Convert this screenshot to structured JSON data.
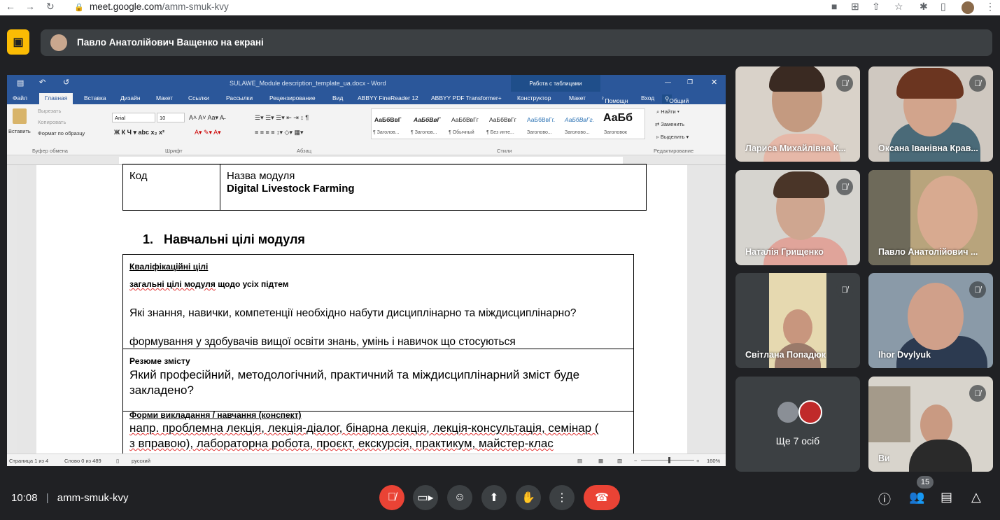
{
  "browser": {
    "url_host": "meet.google.com",
    "url_path": "/amm-smuk-kvy"
  },
  "banner": {
    "presenter_text": "Павло Анатолійович Ващенко на екрані"
  },
  "word": {
    "title": "SULAWE_Module description_template_ua.docx - Word",
    "table_tools": "Работа с таблицами",
    "tabs": [
      "Файл",
      "Главная",
      "Вставка",
      "Дизайн",
      "Макет",
      "Ссылки",
      "Рассылки",
      "Рецензирование",
      "Вид",
      "ABBYY FineReader 12",
      "ABBYY PDF Transformer+",
      "Конструктор",
      "Макет"
    ],
    "help": "Помощн",
    "signin": "Вход",
    "share": "Общий доступ",
    "clipboard": {
      "paste": "Вставить",
      "cut": "Вырезать",
      "copy": "Копировать",
      "format": "Формат по образцу",
      "group": "Буфер обмена"
    },
    "font": {
      "name": "Arial",
      "size": "10",
      "group": "Шрифт"
    },
    "paragraph_group": "Абзац",
    "styles": {
      "samples": [
        "АаБбВвГ",
        "АаБбВвГ",
        "АаБбВвГг",
        "АаБбВвГг",
        "АаБбВвГг.",
        "АаБбВвГг.",
        "АаБб"
      ],
      "names": [
        "¶ Заголов...",
        "¶ Заголов...",
        "¶ Обычный",
        "¶ Без инте...",
        "Заголово...",
        "Заголово...",
        "Заголовок"
      ],
      "group": "Стили"
    },
    "editing": {
      "find": "Найти",
      "replace": "Заменить",
      "select": "Выделить",
      "group": "Редактирование"
    },
    "status": {
      "page": "Страница 1 из 4",
      "words": "Слово 0 из 489",
      "lang": "русский",
      "zoom": "160%"
    }
  },
  "doc": {
    "code_label": "Код",
    "module_name_label": "Назва модуля",
    "module_name": "Digital Livestock Farming",
    "section_number": "1.",
    "section_title": "Навчальні цілі модуля",
    "qual_title": "Кваліфікаційні цілі",
    "goals_a": "загальні цілі модуля",
    "goals_b": " щодо усіх підтем",
    "question1": "Які знання, навички, компетенції необхідно набути дисциплінарно та міждисциплінарно?",
    "formation": "формування у здобувачів вищої освіти знань, умінь і навичок що стосуються",
    "summary_title": "Резюме змісту",
    "summary_text": "Який професійний, методологічний, практичний та міждисциплінарний зміст буде закладено?",
    "forms_title": "Форми викладання / навчання (конспект)",
    "forms_line1": "напр. проблемна лекція, лекція-діалог, бінарна лекція, лекція-консультація, семінар (",
    "forms_line2": "з вправою), лабораторна робота, проєкт, екскурсія, практикум, майстер-клас"
  },
  "participants": [
    {
      "name": "Лариса Михайлівна К...",
      "muted": true
    },
    {
      "name": "Оксана Іванівна Крав...",
      "muted": true
    },
    {
      "name": "Наталія Грищенко",
      "muted": true
    },
    {
      "name": "Павло Анатолійович ...",
      "muted": false
    },
    {
      "name": "Світлана Попадюк",
      "muted": true
    },
    {
      "name": "Ihor Dvylyuk",
      "muted": true
    },
    {
      "name": "Ви",
      "muted": true
    }
  ],
  "others": {
    "label": "Ще 7 осіб"
  },
  "footer": {
    "time": "10:08",
    "separator": "|",
    "meeting_code": "amm-smuk-kvy",
    "participant_count": "15"
  }
}
